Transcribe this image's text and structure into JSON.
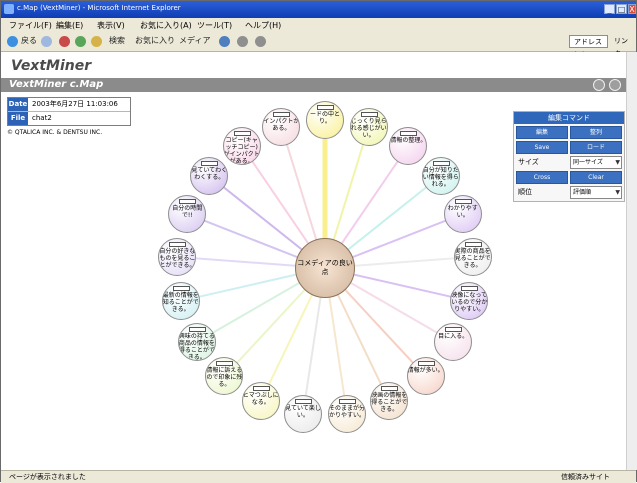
{
  "window": {
    "title": "c.Map (VextMiner) - Microsoft Internet Explorer",
    "minimize": "_",
    "maximize": "□",
    "close": "X"
  },
  "menu": [
    "ファイル(F)",
    "編集(E)",
    "表示(V)",
    "お気に入り(A)",
    "ツール(T)",
    "ヘルプ(H)"
  ],
  "toolbar": {
    "back": "戻る",
    "search": "検索",
    "favorites": "お気に入り",
    "media": "メディア",
    "address_label": "アドレス(D)",
    "link": "リンク"
  },
  "app": {
    "logo": "VextMiner",
    "banner": "VextMiner c.Map"
  },
  "info": {
    "date_label": "Date",
    "date": "2003年6月27日 11:03:06",
    "file_label": "File",
    "file": "chat2"
  },
  "copyright": "© QTALICA INC. & DENTSU INC.",
  "panel": {
    "header": "編集コマンド",
    "buttons": [
      "編集",
      "整列",
      "Save",
      "ロード",
      "Cross",
      "Clear"
    ],
    "size_label": "サイズ",
    "size_value": "同一サイズ",
    "sort_label": "順位",
    "sort_value": "評価順"
  },
  "center_node": "コメディアの良い点",
  "nodes": [
    {
      "label": "ードの中とり。",
      "color": "#f9ef8d"
    },
    {
      "label": "じっくり見られる感じがいい。",
      "color": "#f0f5a8"
    },
    {
      "label": "情報の整理。",
      "color": "#f3ccec"
    },
    {
      "label": "自分が知りたい情報を得られる。",
      "color": "#c7f1ec"
    },
    {
      "label": "わかりやすい。",
      "color": "#d9c1f3"
    },
    {
      "label": "実際の商品を見ることができる。",
      "color": "#ececec"
    },
    {
      "label": "映像になっているので分かりやすい。",
      "color": "#d8c0f3"
    },
    {
      "label": "目に入る。",
      "color": "#f5dce9"
    },
    {
      "label": "情報が多い。",
      "color": "#f6cfc2"
    },
    {
      "label": "映画の情報を得ることができる。",
      "color": "#f2ddc7"
    },
    {
      "label": "そのままが分かりやすい。",
      "color": "#f6e7ce"
    },
    {
      "label": "見ていて楽しい。",
      "color": "#e8e8e8"
    },
    {
      "label": "ヒマつぶしになる。",
      "color": "#f7f5b8"
    },
    {
      "label": "情報に訴えるので印象に残る。",
      "color": "#eaf6c8"
    },
    {
      "label": "興味の持てる商品の情報を得ることができる。",
      "color": "#d6f2de"
    },
    {
      "label": "最新の情報を知ることができる。",
      "color": "#cdeff3"
    },
    {
      "label": "自分の好きなものを見ることができる。",
      "color": "#e2d9f5"
    },
    {
      "label": "自分の時間で!!",
      "color": "#d4c4f0"
    },
    {
      "label": "見ていてわくわくする。",
      "color": "#cdb7ec"
    },
    {
      "label": "コピー(キャッチコピー)がインパクトがある。",
      "color": "#f8cfe3"
    },
    {
      "label": "インパクトがある。",
      "color": "#f5d7dd"
    }
  ],
  "status": {
    "left": "ページが表示されました",
    "right": "信頼済みサイト"
  }
}
